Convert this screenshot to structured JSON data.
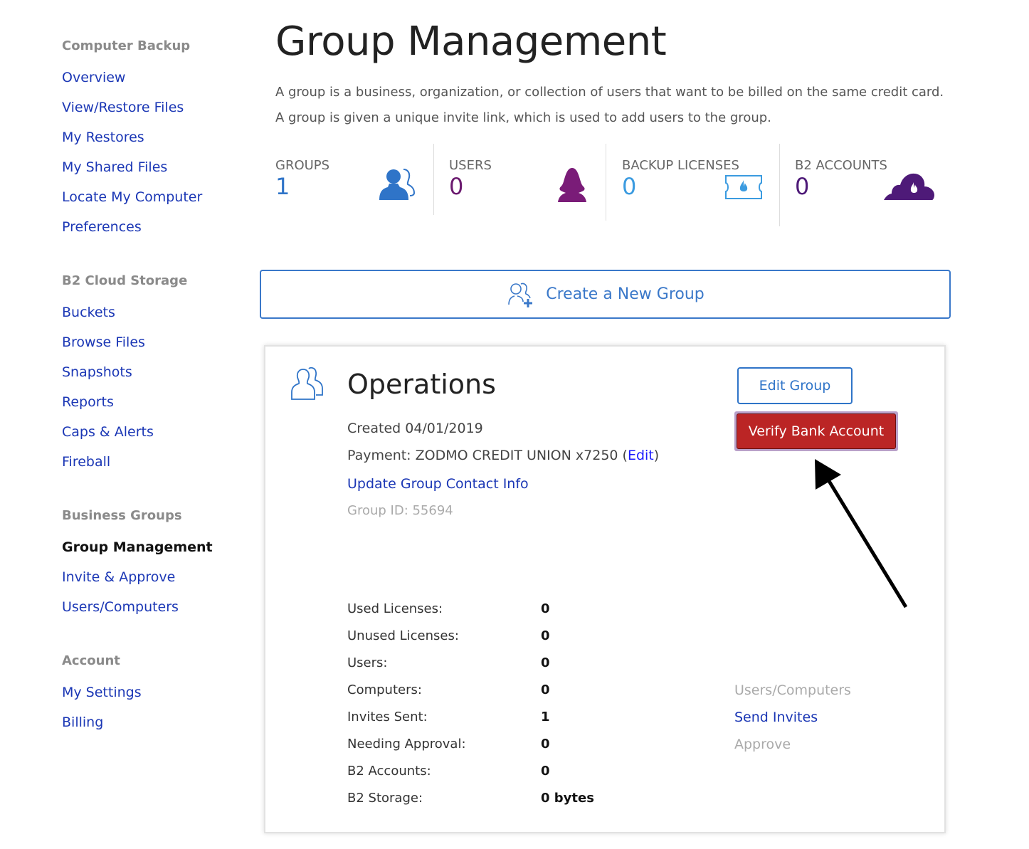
{
  "sidebar": {
    "sections": [
      {
        "heading": "Computer Backup",
        "items": [
          "Overview",
          "View/Restore Files",
          "My Restores",
          "My Shared Files",
          "Locate My Computer",
          "Preferences"
        ]
      },
      {
        "heading": "B2 Cloud Storage",
        "items": [
          "Buckets",
          "Browse Files",
          "Snapshots",
          "Reports",
          "Caps & Alerts",
          "Fireball"
        ]
      },
      {
        "heading": "Business Groups",
        "items": [
          "Group Management",
          "Invite & Approve",
          "Users/Computers"
        ]
      },
      {
        "heading": "Account",
        "items": [
          "My Settings",
          "Billing"
        ]
      }
    ],
    "active": "Group Management"
  },
  "page": {
    "title": "Group Management",
    "description": "A group is a business, organization, or collection of users that want to be billed on the same credit card. A group is given a unique invite link, which is used to add users to the group."
  },
  "stats": [
    {
      "label": "GROUPS",
      "value": "1",
      "color": "#2f74c8",
      "icon": "group-users-icon"
    },
    {
      "label": "USERS",
      "value": "0",
      "color": "#6b1a6f",
      "icon": "user-icon"
    },
    {
      "label": "BACKUP LICENSES",
      "value": "0",
      "color": "#3b9be0",
      "icon": "license-ticket-icon"
    },
    {
      "label": "B2 ACCOUNTS",
      "value": "0",
      "color": "#4e1a78",
      "icon": "cloud-flame-icon"
    }
  ],
  "create_button": "Create a New Group",
  "group": {
    "name": "Operations",
    "created": "Created 04/01/2019",
    "payment_prefix": "Payment: ZODMO CREDIT UNION x7250 (",
    "payment_edit": "Edit",
    "payment_suffix": ")",
    "update_contact": "Update Group Contact Info",
    "group_id": "Group ID: 55694",
    "edit_button": "Edit Group",
    "verify_button": "Verify Bank Account",
    "details": [
      {
        "label": "Used Licenses:",
        "value": "0"
      },
      {
        "label": "Unused Licenses:",
        "value": "0"
      },
      {
        "label": "Users:",
        "value": "0"
      },
      {
        "label": "Computers:",
        "value": "0",
        "link": "Users/Computers",
        "link_enabled": false
      },
      {
        "label": "Invites Sent:",
        "value": "1",
        "link": "Send Invites",
        "link_enabled": true
      },
      {
        "label": "Needing Approval:",
        "value": "0",
        "link": "Approve",
        "link_enabled": false
      },
      {
        "label": "B2 Accounts:",
        "value": "0"
      },
      {
        "label": "B2 Storage:",
        "value": "0 bytes"
      }
    ]
  }
}
